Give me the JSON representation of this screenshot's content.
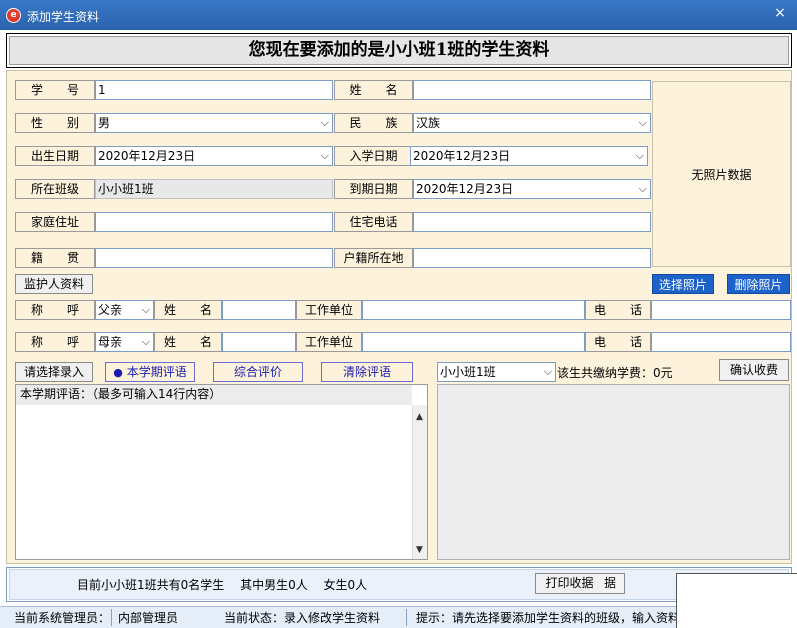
{
  "window": {
    "title": "添加学生资料",
    "app_icon_glyph": "e",
    "close_glyph": "×"
  },
  "header": {
    "title": "您现在要添加的是小小班1班的学生资料"
  },
  "form": {
    "student_no_label": "学　　号",
    "student_no_value": "1",
    "name_label": "姓　　名",
    "name_value": "",
    "gender_label": "性　　别",
    "gender_value": "男",
    "ethnicity_label": "民　　族",
    "ethnicity_value": "汉族",
    "birth_date_label": "出生日期",
    "birth_date_value": "2020年12月23日",
    "enroll_date_label": "入学日期",
    "enroll_date_value": "2020年12月23日",
    "class_label": "所在班级",
    "class_value": "小小班1班",
    "expire_date_label": "到期日期",
    "expire_date_value": "2020年12月23日",
    "address_label": "家庭住址",
    "address_value": "",
    "home_phone_label": "住宅电话",
    "home_phone_value": "",
    "native_place_label": "籍　　贯",
    "native_place_value": "",
    "hukou_label": "户籍所在地",
    "hukou_value": "",
    "photo_placeholder": "无照片数据"
  },
  "buttons": {
    "guardian_info": "监护人资料",
    "select_photo": "选择照片",
    "delete_photo": "删除照片",
    "select_entry": "请选择录入",
    "this_term_comment": "本学期评语",
    "overall_eval": "综合评价",
    "clear_comment": "清除评语",
    "confirm_fee": "确认收费",
    "print_receipt": "打印收据",
    "print_receipt_edge": "据"
  },
  "guardians": [
    {
      "title_label": "称　　呼",
      "title_value": "父亲",
      "name_label": "姓　　名",
      "name_value": "",
      "work_label": "工作单位",
      "work_value": "",
      "phone_label": "电　　话",
      "phone_value": ""
    },
    {
      "title_label": "称　　呼",
      "title_value": "母亲",
      "name_label": "姓　　名",
      "name_value": "",
      "work_label": "工作单位",
      "work_value": "",
      "phone_label": "电　　话",
      "phone_value": ""
    }
  ],
  "comment": {
    "header": "本学期评语：（最多可输入14行内容）",
    "radio_glyph": "●",
    "scroll_up_glyph": "▲",
    "scroll_down_glyph": "▼"
  },
  "fee": {
    "class_select_value": "小小班1班",
    "summary": "该生共缴纳学费：0元"
  },
  "summary": {
    "text": "目前小小班1班共有0名学生　 其中男生0人　 女生0人"
  },
  "status": {
    "admin_label": "当前系统管理员：",
    "admin_value": "内部管理员",
    "state": "当前状态：录入修改学生资料",
    "tip": "提示：请先选择要添加学生资料的班级，输入资料"
  },
  "icons": {
    "dropdown": "chevron-down-icon",
    "dropdown_glyph": "⌵"
  },
  "colors": {
    "titlebar": "#2a63ad",
    "form_bg": "#fdf2dc",
    "accent_button": "#1c62c8"
  }
}
